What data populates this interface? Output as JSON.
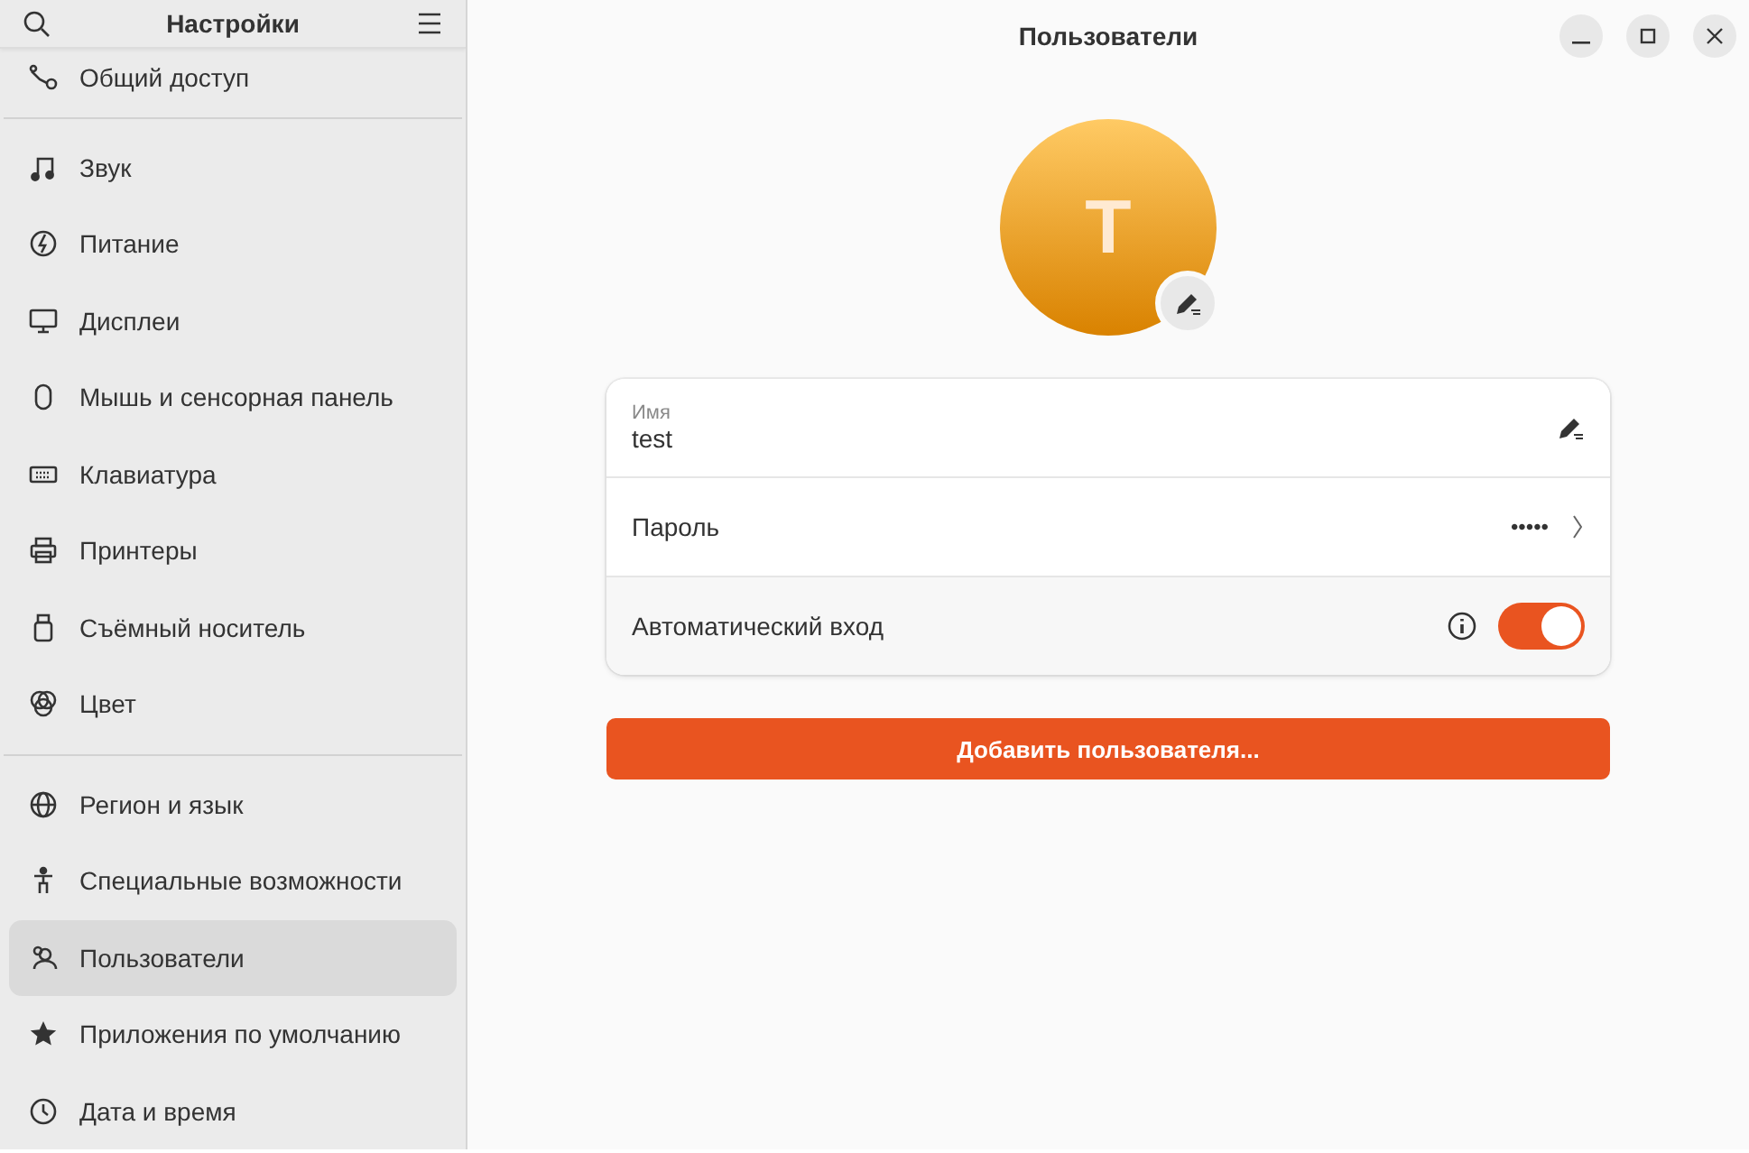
{
  "sidebar": {
    "title": "Настройки",
    "groups": [
      {
        "items": [
          {
            "label": "Общий доступ",
            "selected": false
          }
        ]
      },
      {
        "items": [
          {
            "label": "Звук",
            "selected": false
          },
          {
            "label": "Питание",
            "selected": false
          },
          {
            "label": "Дисплеи",
            "selected": false
          },
          {
            "label": "Мышь и сенсорная панель",
            "selected": false
          },
          {
            "label": "Клавиатура",
            "selected": false
          },
          {
            "label": "Принтеры",
            "selected": false
          },
          {
            "label": "Съёмный носитель",
            "selected": false
          },
          {
            "label": "Цвет",
            "selected": false
          }
        ]
      },
      {
        "items": [
          {
            "label": "Регион и язык",
            "selected": false
          },
          {
            "label": "Специальные возможности",
            "selected": false
          },
          {
            "label": "Пользователи",
            "selected": true
          },
          {
            "label": "Приложения по умолчанию",
            "selected": false
          },
          {
            "label": "Дата и время",
            "selected": false
          }
        ]
      }
    ]
  },
  "window": {
    "title": "Пользователи"
  },
  "avatar": {
    "initial": "T"
  },
  "account": {
    "name_label": "Имя",
    "name": "test",
    "password_label": "Пароль",
    "password": "•••••",
    "autologin_label": "Автоматический вход",
    "autologin": true
  },
  "add_button": "Добавить пользователя..."
}
